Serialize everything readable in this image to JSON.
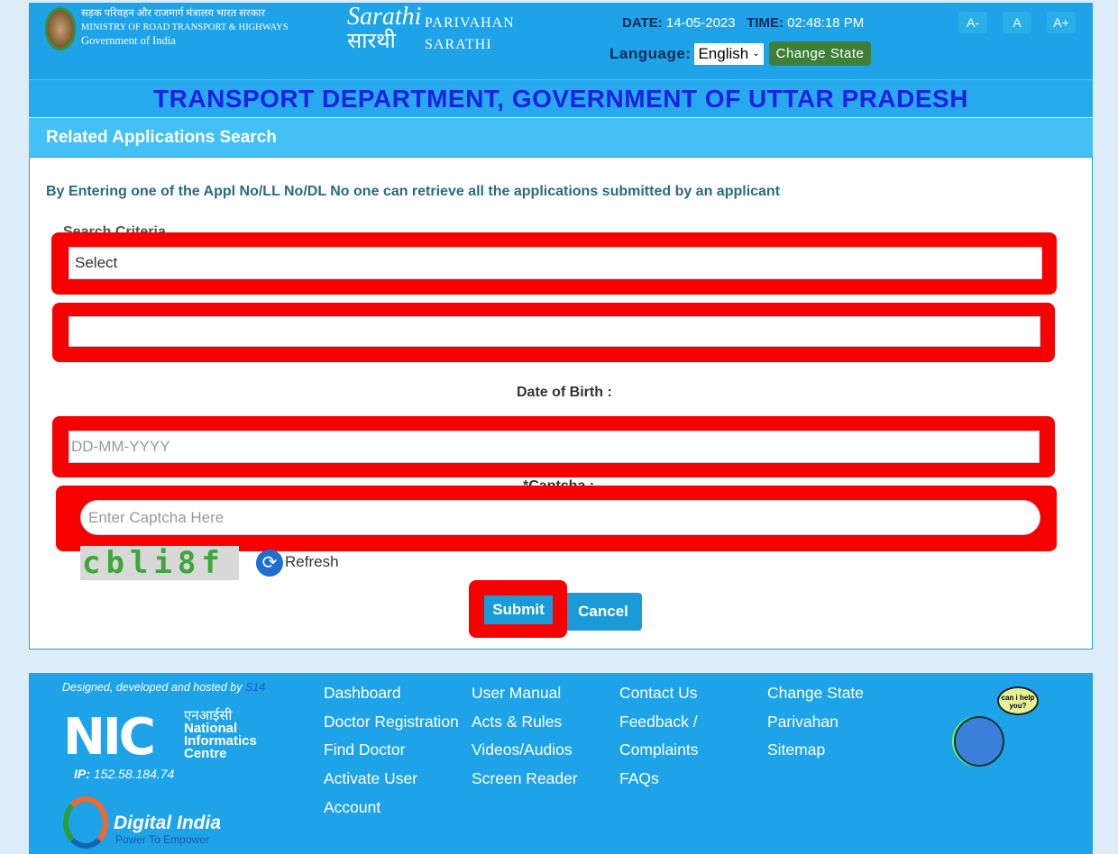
{
  "header": {
    "ministry_hindi": "सड़क परिवहन और राजमार्ग मंत्रालय भारत सरकार",
    "ministry": "MINISTRY OF ROAD TRANSPORT & HIGHWAYS",
    "govt": "Government of India",
    "logo_text": "Sarathi",
    "logo_hindi": "सारथी",
    "brand_line1": "PARIVAHAN",
    "brand_line2": "SARATHI",
    "date_label": "DATE:",
    "date": "14-05-2023",
    "time_label": "TIME:",
    "time": "02:48:18 PM",
    "language_label": "Language:",
    "language": "English",
    "change_state": "Change State",
    "font_small": "A-",
    "font_normal": "A",
    "font_large": "A+",
    "department": "TRANSPORT DEPARTMENT, GOVERNMENT OF UTTAR PRADESH"
  },
  "panel": {
    "title": "Related Applications Search",
    "info": "By Entering one of the Appl No/LL No/DL No one can retrieve all the applications submitted by an applicant",
    "search_criteria_label": "Search Criteria",
    "search_criteria_value": "Select",
    "number_value": "",
    "dob_label": "Date of Birth :",
    "dob_placeholder": "DD-MM-YYYY",
    "captcha_label": "*Captcha :",
    "captcha_placeholder": "Enter Captcha Here",
    "captcha_image_text": "cbli8f",
    "refresh": "Refresh",
    "submit": "Submit",
    "cancel": "Cancel"
  },
  "footer": {
    "credit": "Designed, developed and hosted by",
    "credit_org": "S14",
    "nic_hindi": "एनआईसी",
    "nic_name": "National Informatics Centre",
    "ip_label": "IP:",
    "ip": "152.58.184.74",
    "digital_india": "Digital India",
    "digital_india_tag": "Power To Empower",
    "help_bubble": "can i help you?",
    "links_col1": [
      "Dashboard",
      "Doctor Registration",
      "Find Doctor",
      "Activate User Account"
    ],
    "links_col2": [
      "User Manual",
      "Acts & Rules",
      "Videos/Audios",
      "Screen Reader"
    ],
    "links_col3": [
      "Contact Us",
      "Feedback / Complaints",
      "FAQs"
    ],
    "links_col4": [
      "Change State",
      "Parivahan",
      "Sitemap"
    ]
  },
  "colors": {
    "header": "#1ea3e8",
    "panel_header": "#43c0f5",
    "highlight": "#f70000",
    "change_state": "#3f7f38"
  }
}
